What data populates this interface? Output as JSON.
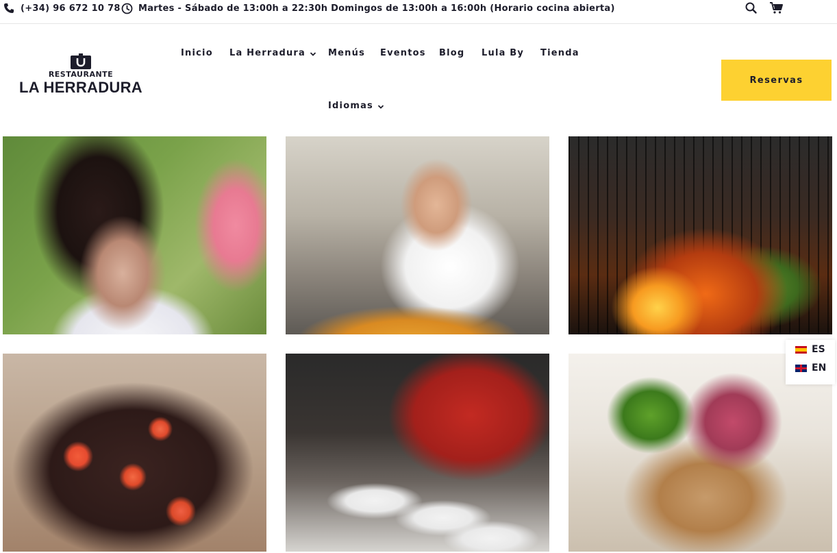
{
  "topbar": {
    "phone": "(+34) 96 672 10 78",
    "hours": "Martes - Sábado de 13:00h a 22:30h Domingos de 13:00h a 16:00h (Horario cocina abierta)",
    "phone_icon": "phone-icon",
    "clock_icon": "clock-icon",
    "search_icon": "search-icon",
    "cart_icon": "cart-icon"
  },
  "logo": {
    "top": "RESTAURANTE",
    "main": "LA HERRADURA"
  },
  "nav": {
    "items": [
      {
        "label": "Inicio"
      },
      {
        "label": "La Herradura"
      },
      {
        "label": "Menús"
      },
      {
        "label": "Eventos"
      },
      {
        "label": "Blog"
      },
      {
        "label": "Lula By"
      },
      {
        "label": "Tienda"
      },
      {
        "label": "Idiomas"
      }
    ],
    "cta": "Reservas"
  },
  "gallery": {
    "photos": [
      {
        "name": "chef-portrait-photo"
      },
      {
        "name": "paella-event-photo"
      },
      {
        "name": "grill-fire-photo"
      },
      {
        "name": "tomato-dish-photo"
      },
      {
        "name": "plating-kitchen-photo"
      },
      {
        "name": "gourmet-plate-photo"
      }
    ]
  },
  "language_switcher": {
    "items": [
      {
        "code": "ES",
        "flag": "spain-flag-icon"
      },
      {
        "code": "EN",
        "flag": "uk-flag-icon"
      }
    ]
  },
  "colors": {
    "accent": "#fdd131",
    "text": "#1d1d2b"
  }
}
